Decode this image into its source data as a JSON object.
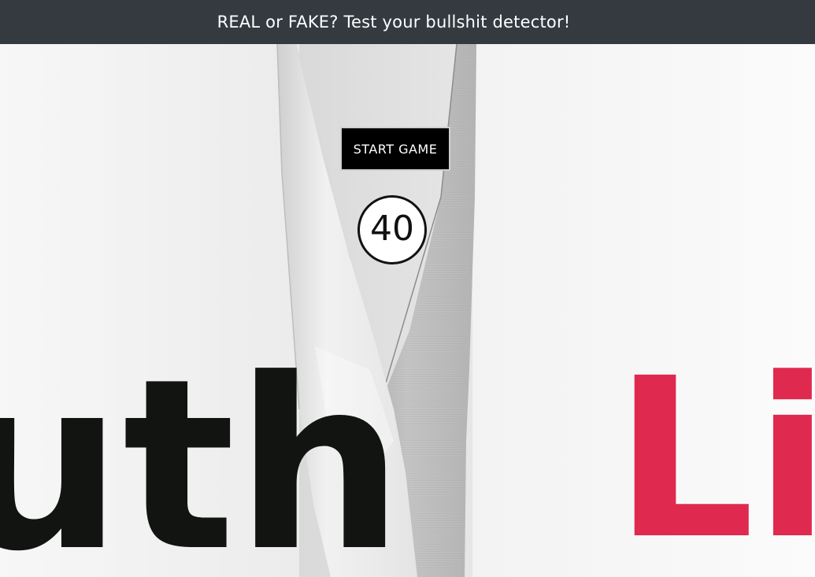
{
  "header": {
    "title": "REAL or FAKE? Test your bullshit detector!"
  },
  "controls": {
    "start_label": "START GAME"
  },
  "timer": {
    "value": "40"
  },
  "background": {
    "left_word": "uth",
    "right_word": "Li",
    "left_word_color": "#111411",
    "right_word_color": "#e0294f"
  },
  "colors": {
    "header_bg": "#343a40",
    "button_bg": "#000000"
  }
}
